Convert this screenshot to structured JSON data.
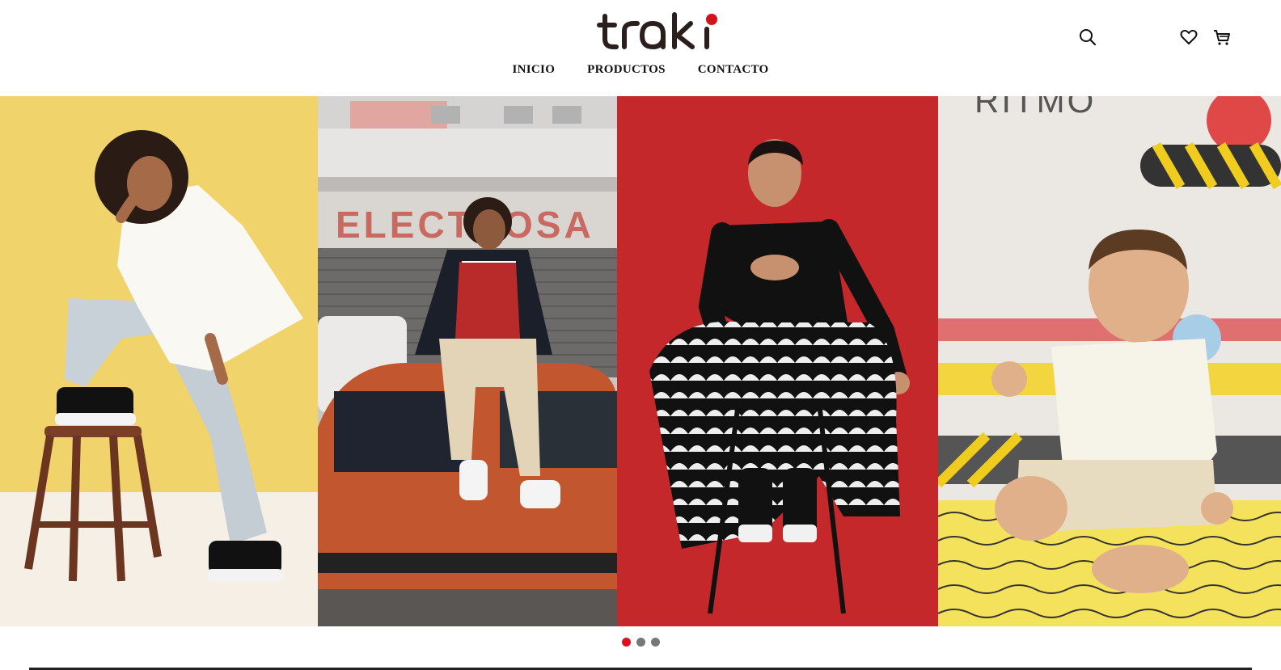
{
  "brand": {
    "name": "traki",
    "accent_color": "#d3121b",
    "text_color": "#2a1f1c"
  },
  "nav": {
    "items": [
      {
        "label": "INICIO"
      },
      {
        "label": "PRODUCTOS"
      },
      {
        "label": "CONTACTO"
      }
    ]
  },
  "header_icons": [
    "search-icon",
    "heart-icon",
    "cart-icon"
  ],
  "hero": {
    "slides_count": 3,
    "active_slide": 1,
    "panels": [
      {
        "name": "woman-yellow-background",
        "bg": "#f0d36a"
      },
      {
        "name": "man-on-orange-car",
        "bg": "#c9c7c4",
        "sign_text": "ELECTROSA"
      },
      {
        "name": "woman-red-background",
        "bg": "#c4282a"
      },
      {
        "name": "baby-playroom",
        "bg": "#e9e6e0",
        "wall_text": "RITMO"
      }
    ]
  },
  "dot_colors": {
    "active": "#e01020",
    "inactive": "#777777"
  }
}
